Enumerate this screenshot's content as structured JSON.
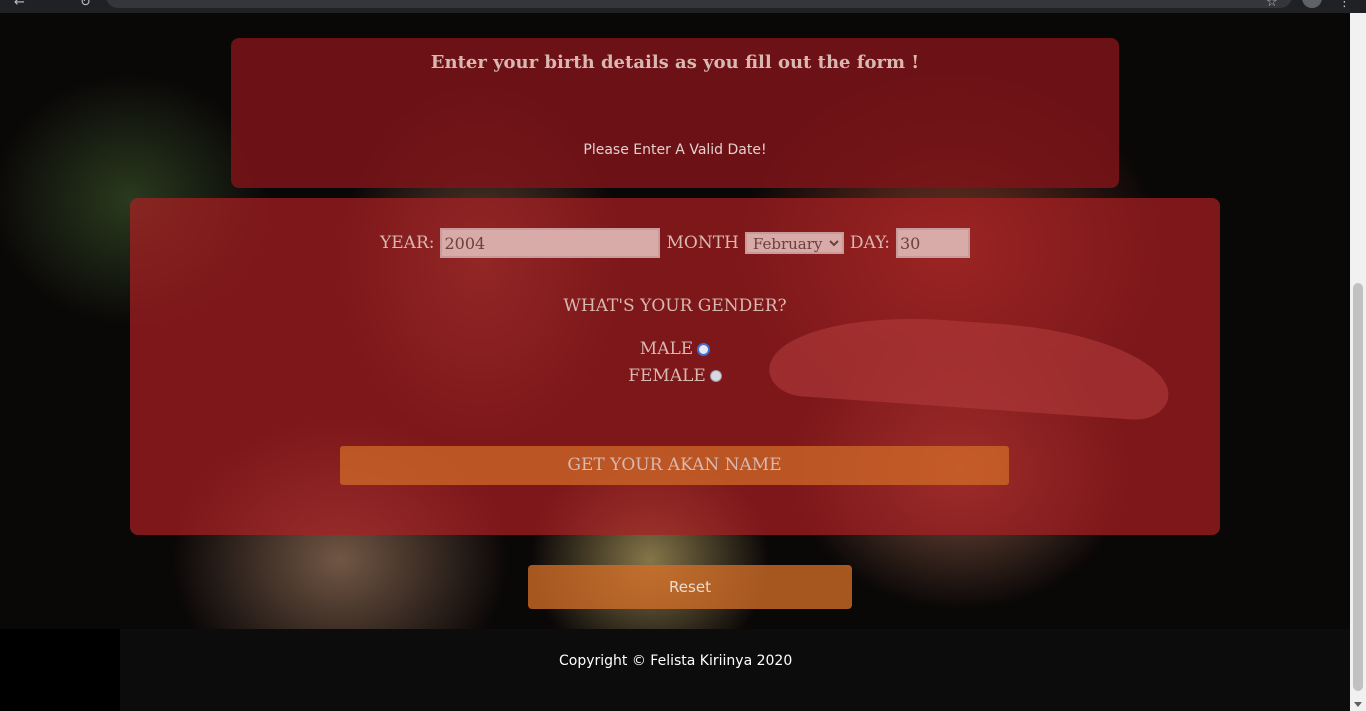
{
  "header": {
    "intro_text": "Enter your birth details as you fill out the form !",
    "error_message": "Please Enter A Valid Date!"
  },
  "form": {
    "year_label": "YEAR:",
    "year_value": "2004",
    "month_label": "MONTH",
    "month_value": "February",
    "day_label": "DAY:",
    "day_value": "30",
    "gender_question": "WHAT'S YOUR GENDER?",
    "male_label": "MALE",
    "female_label": "FEMALE",
    "submit_label": "GET YOUR AKAN NAME"
  },
  "reset_label": "Reset",
  "footer": {
    "copyright": "Copyright © Felista Kiriinya 2020"
  },
  "colors": {
    "panel_red": "#7d1418",
    "button_orange": "#d26e28",
    "footer_bg": "#0e0c0c"
  },
  "icons": {
    "back": "back-arrow-icon",
    "reload": "reload-icon",
    "star": "star-icon",
    "menu": "menu-dots-icon"
  }
}
